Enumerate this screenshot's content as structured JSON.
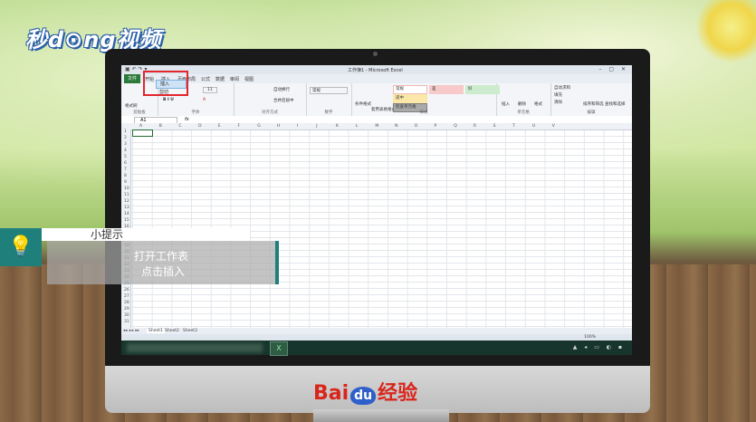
{
  "brand": {
    "top_logo": "秒d⊙ng视频",
    "bottom_logo_bai": "Bai",
    "bottom_logo_du": "du",
    "bottom_logo_rest": "经验"
  },
  "window": {
    "title": "工作簿1 - Microsoft Excel",
    "quick_access": "▣ ↶ ↷ ▾",
    "controls": "– ▢ ✕"
  },
  "ribbon_tabs": [
    "文件",
    "开始",
    "插入",
    "页面布局",
    "公式",
    "数据",
    "审阅",
    "视图"
  ],
  "context_menu": [
    "插入",
    "剪切",
    "常用",
    "复制"
  ],
  "ribbon": {
    "groups": [
      "剪贴板",
      "字体",
      "对齐方式",
      "数字",
      "样式",
      "单元格",
      "编辑"
    ],
    "font_size": "11",
    "wrap_text": "自动换行",
    "merge": "合并后居中",
    "number_format": "常规",
    "cond_format": "条件格式",
    "table_format": "套用表格格式",
    "styles": [
      {
        "label": "常规",
        "bg": "#ffffff",
        "border": "#f0b8b8"
      },
      {
        "label": "差",
        "bg": "#f7c9c9",
        "border": "#f7c9c9"
      },
      {
        "label": "好",
        "bg": "#cdeccd",
        "border": "#cdeccd"
      },
      {
        "label": "适中",
        "bg": "#fbe7a8",
        "border": "#fbe7a8"
      },
      {
        "label": "检查单元格",
        "bg": "#a9a9a9",
        "border": "#7f7f7f"
      }
    ],
    "cells": [
      "插入",
      "删除",
      "格式"
    ],
    "editing": [
      "自动求和",
      "填充",
      "清除",
      "排序和筛选",
      "查找和选择"
    ],
    "format_painter": "格式刷"
  },
  "formula_bar": {
    "name_box": "A1",
    "fx": "fx"
  },
  "columns": [
    "A",
    "B",
    "C",
    "D",
    "E",
    "F",
    "G",
    "H",
    "I",
    "J",
    "K",
    "L",
    "M",
    "N",
    "O",
    "P",
    "Q",
    "R",
    "S",
    "T",
    "U",
    "V"
  ],
  "rows": [
    "1",
    "2",
    "3",
    "4",
    "5",
    "6",
    "7",
    "8",
    "9",
    "10",
    "11",
    "12",
    "13",
    "14",
    "15",
    "16",
    "17",
    "18",
    "19",
    "20",
    "21",
    "22",
    "23",
    "24",
    "25",
    "26",
    "27",
    "28",
    "29",
    "30",
    "31"
  ],
  "sheet_tabs": [
    "Sheet1",
    "Sheet2",
    "Sheet3"
  ],
  "status": {
    "zoom": "100%"
  },
  "tip": {
    "heading": "小提示",
    "line1": "打开工作表",
    "line2": "点击插入",
    "icon": "lightbulb-icon"
  }
}
